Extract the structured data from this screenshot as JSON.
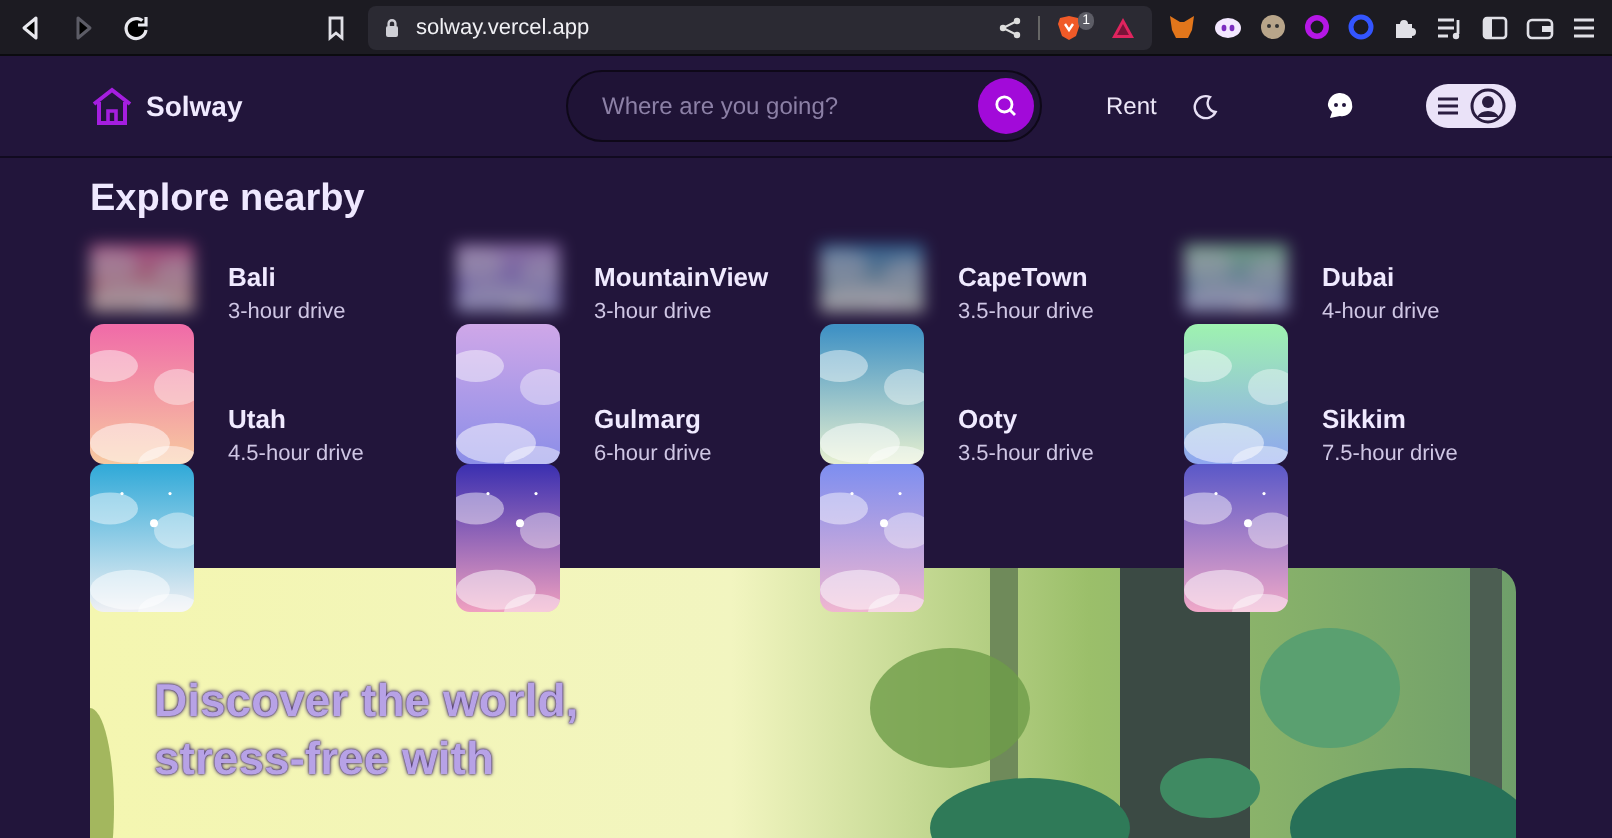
{
  "browser": {
    "nav_buttons": [
      {
        "kind": "back",
        "disabled": false
      },
      {
        "kind": "forward",
        "disabled": true
      },
      {
        "kind": "reload",
        "disabled": false
      }
    ],
    "url": "solway.vercel.app",
    "shield_badge": "1"
  },
  "header": {
    "logo": "Solway",
    "search": {
      "placeholder": "Where are you going?"
    },
    "link": "Rent"
  },
  "explore": {
    "title": "Explore nearby",
    "places": [
      {
        "name": "Bali",
        "drive": "3-hour drive"
      },
      {
        "name": "MountainView",
        "drive": "3-hour drive"
      },
      {
        "name": "CapeTown",
        "drive": "3.5-hour drive"
      },
      {
        "name": "Dubai",
        "drive": "4-hour drive"
      },
      {
        "name": "Utah",
        "drive": "4.5-hour drive"
      },
      {
        "name": "Gulmarg",
        "drive": "6-hour drive"
      },
      {
        "name": "Ooty",
        "drive": "3.5-hour drive"
      },
      {
        "name": "Sikkim",
        "drive": "7.5-hour drive"
      }
    ]
  },
  "hero": {
    "headline": "Discover the world, stress-free with"
  }
}
